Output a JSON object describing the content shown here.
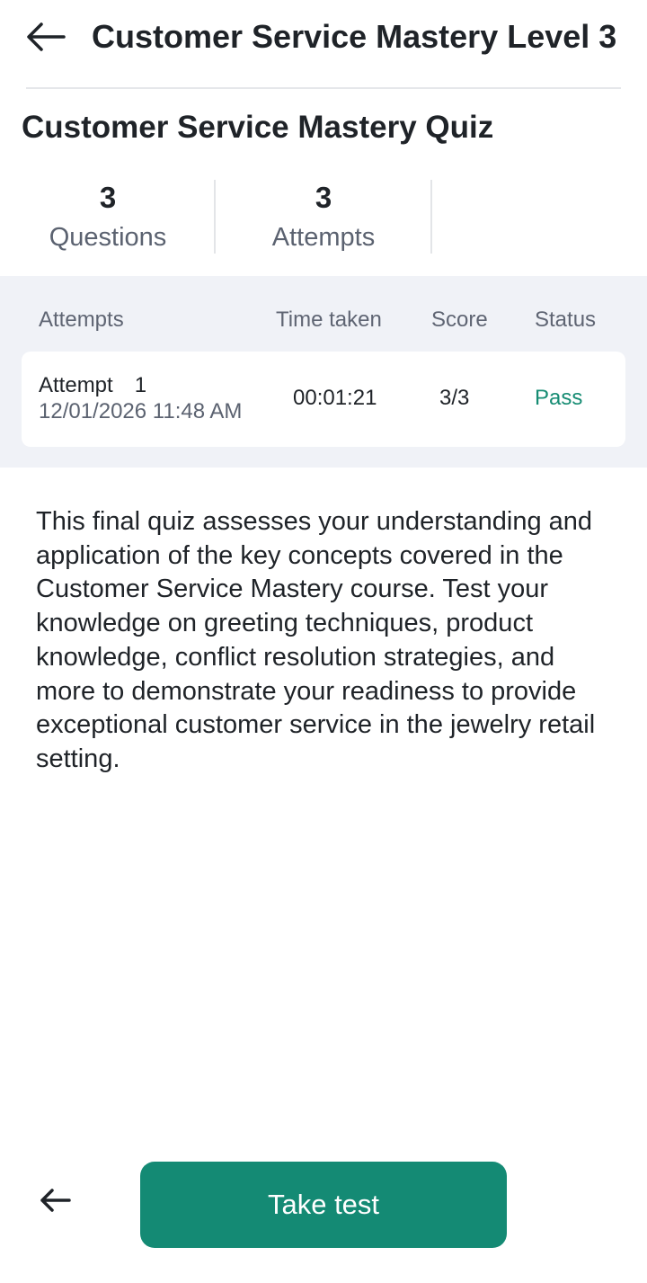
{
  "header": {
    "title": "Customer Service Mastery Level 3",
    "back_icon": "arrow-left-icon"
  },
  "quiz": {
    "title": "Customer Service Mastery Quiz",
    "stats": [
      {
        "value": "3",
        "label": "Questions"
      },
      {
        "value": "3",
        "label": "Attempts"
      }
    ]
  },
  "attempts_table": {
    "headers": {
      "attempts": "Attempts",
      "time_taken": "Time taken",
      "score": "Score",
      "status": "Status"
    },
    "rows": [
      {
        "attempt_label": "Attempt",
        "attempt_number": "1",
        "datetime": "12/01/2026 11:48 AM",
        "time_taken": "00:01:21",
        "score": "3/3",
        "status": "Pass"
      }
    ]
  },
  "description": "This final quiz assesses your understanding and application of the key concepts covered in the Customer Service Mastery course. Test your knowledge on greeting techniques, product knowledge, conflict resolution strategies, and more to demonstrate your readiness to provide exceptional customer service in the jewelry retail setting.",
  "footer": {
    "back_icon": "arrow-left-icon",
    "take_test_label": "Take test"
  },
  "colors": {
    "accent": "#148a74",
    "pass": "#168c73",
    "panel_bg": "#f0f2f7"
  }
}
